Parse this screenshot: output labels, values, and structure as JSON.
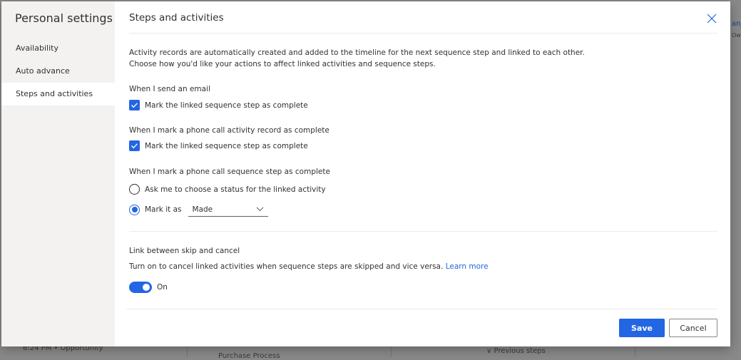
{
  "background": {
    "fragments": [
      "6:24 PM • Opportunity",
      "Purchase Process",
      "Previous steps",
      "anj",
      "Own"
    ]
  },
  "sidebar": {
    "title": "Personal settings",
    "items": [
      {
        "label": "Availability"
      },
      {
        "label": "Auto advance"
      },
      {
        "label": "Steps and activities",
        "selected": true
      }
    ]
  },
  "main": {
    "title": "Steps and activities",
    "intro": [
      "Activity records are automatically created and added to the timeline for the next sequence step and linked to each other.",
      "Choose how you'd like your actions to affect linked activities and sequence steps."
    ],
    "email": {
      "heading": "When I send an email",
      "checkbox": "Mark the linked sequence step as complete",
      "checked": true
    },
    "phone_activity": {
      "heading": "When I mark a phone call activity record as complete",
      "checkbox": "Mark the linked sequence step as complete",
      "checked": true
    },
    "phone_step": {
      "heading": "When I mark a phone call sequence step as complete",
      "option_ask": "Ask me to choose a status for the linked activity",
      "option_mark": "Mark it as",
      "selected_option": "mark",
      "status_value": "Made"
    },
    "skip": {
      "heading": "Link between skip and cancel",
      "description": "Turn on to cancel linked activities when sequence steps are skipped and vice versa.",
      "learn_more": "Learn more",
      "toggle_on": true,
      "toggle_label": "On"
    }
  },
  "footer": {
    "save": "Save",
    "cancel": "Cancel"
  },
  "colors": {
    "accent": "#2266e3",
    "sidebar_bg": "#f3f2f1"
  }
}
